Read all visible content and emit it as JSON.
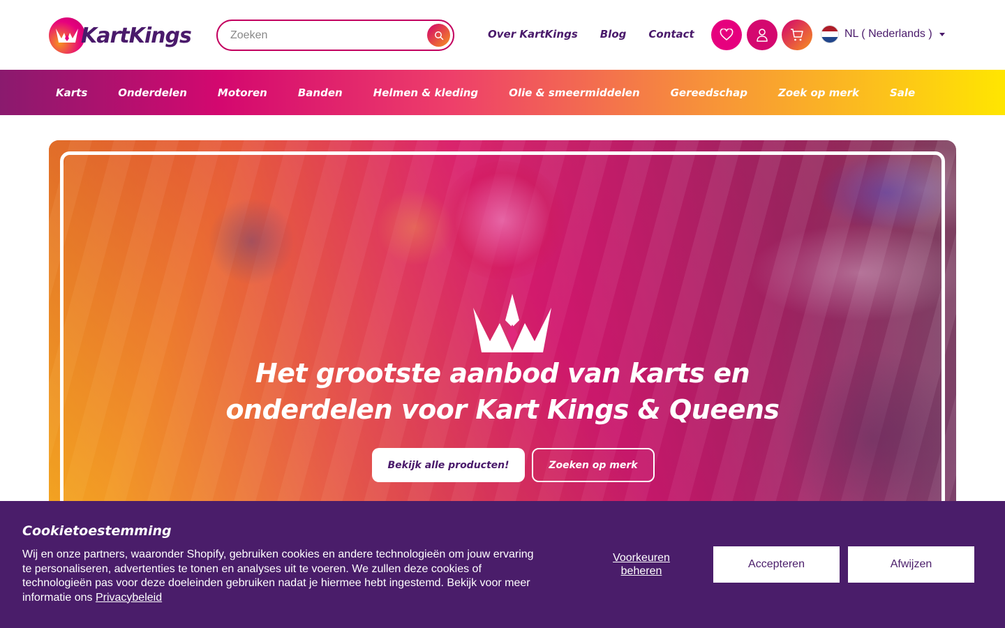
{
  "header": {
    "logo_text": "KartKings",
    "search": {
      "placeholder": "Zoeken"
    },
    "links": [
      "Over KartKings",
      "Blog",
      "Contact"
    ],
    "icons": [
      "heart-icon",
      "user-icon",
      "cart-icon"
    ],
    "language": "NL ( Nederlands )"
  },
  "nav": {
    "items": [
      "Karts",
      "Onderdelen",
      "Motoren",
      "Banden",
      "Helmen & kleding",
      "Olie & smeermiddelen",
      "Gereedschap",
      "Zoek op merk",
      "Sale"
    ]
  },
  "hero": {
    "title_line1": "Het grootste aanbod van karts en",
    "title_line2": "onderdelen voor Kart Kings & Queens",
    "primary_button": "Bekijk alle producten!",
    "secondary_button": "Zoeken op merk"
  },
  "cookie": {
    "title": "Cookietoestemming",
    "text": "Wij en onze partners, waaronder Shopify, gebruiken cookies en andere technologieën om jouw ervaring te personaliseren, advertenties te tonen en analyses uit te voeren. We zullen deze cookies of technologieën pas voor deze doeleinden gebruiken nadat je hiermee hebt ingestemd. Bekijk voor meer informatie ons",
    "privacy_link": "Privacybeleid",
    "preferences_line1": "Voorkeuren",
    "preferences_line2": "beheren",
    "accept": "Accepteren",
    "reject": "Afwijzen"
  },
  "colors": {
    "brand_purple": "#4a1a6b",
    "brand_pink": "#e6007e",
    "brand_yellow": "#ffe600",
    "cookie_bg": "#4a1d6a"
  }
}
